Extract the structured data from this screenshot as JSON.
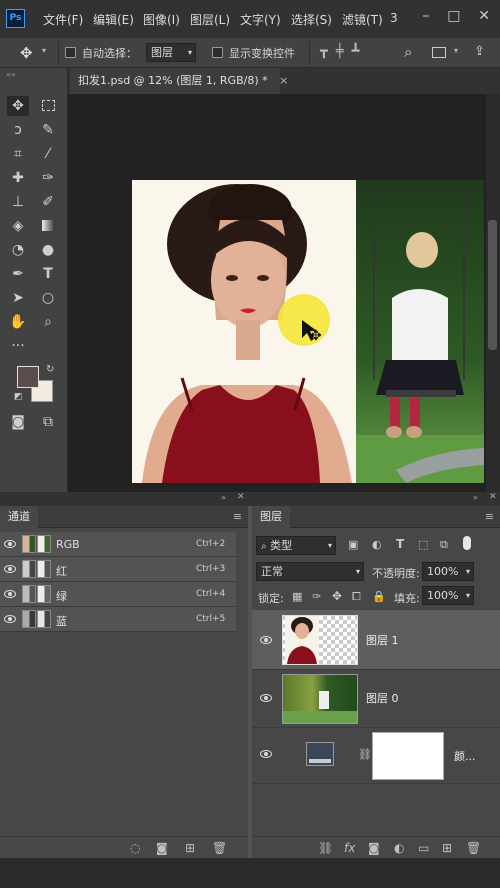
{
  "app": {
    "logo": "Ps"
  },
  "menu": [
    "文件(F)",
    "编辑(E)",
    "图像(I)",
    "图层(L)",
    "文字(Y)",
    "选择(S)",
    "滤镜(T)",
    "3"
  ],
  "window_controls": {
    "minimize": "–",
    "restore": "□",
    "close": "✕"
  },
  "options": {
    "auto_select_label": "自动选择：",
    "auto_select_target": "图层",
    "show_transform_label": "显示变换控件"
  },
  "document": {
    "tab_title": "扣发1.psd @ 12% (图层 1, RGB/8) *",
    "tab_close": "×"
  },
  "channels_panel": {
    "title": "通道",
    "channels": [
      {
        "name": "RGB",
        "shortcut": "Ctrl+2"
      },
      {
        "name": "红",
        "shortcut": "Ctrl+3"
      },
      {
        "name": "绿",
        "shortcut": "Ctrl+4"
      },
      {
        "name": "蓝",
        "shortcut": "Ctrl+5"
      }
    ]
  },
  "layers_panel": {
    "title": "图层",
    "filter_kind": "类型",
    "blend_mode": "正常",
    "opacity_label": "不透明度:",
    "opacity_value": "100%",
    "lock_label": "锁定:",
    "fill_label": "填充:",
    "fill_value": "100%",
    "layers": [
      {
        "name": "图层 1"
      },
      {
        "name": "图层 0"
      },
      {
        "name": "颜..."
      }
    ]
  },
  "colors": {
    "foreground": "#5b4c4d",
    "background": "#f2ece0",
    "accent": "#3aa0ff"
  }
}
